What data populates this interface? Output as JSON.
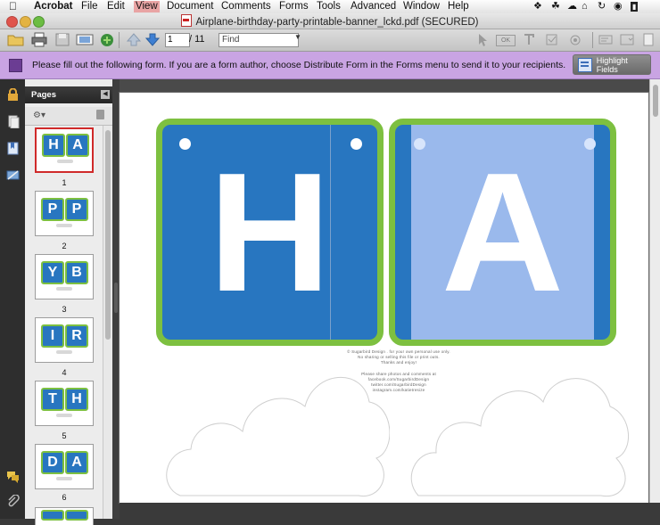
{
  "menubar": {
    "app": "Acrobat",
    "items": [
      "File",
      "Edit",
      "View",
      "Document",
      "Comments",
      "Forms",
      "Tools",
      "Advanced",
      "Window",
      "Help"
    ]
  },
  "window": {
    "title": "Airplane-birthday-party-printable-banner_lckd.pdf (SECURED)"
  },
  "toolbar": {
    "page_value": "1",
    "page_count": "/  11",
    "find_placeholder": "Find"
  },
  "formbar": {
    "message": "Please fill out the following form. If you are a form author, choose Distribute Form in the Forms menu to send it to your recipients.",
    "highlight_label": "Highlight Fields"
  },
  "pages_panel": {
    "title": "Pages",
    "thumbnails": [
      {
        "left": "H",
        "right": "A",
        "number": "1"
      },
      {
        "left": "P",
        "right": "P",
        "number": "2"
      },
      {
        "left": "Y",
        "right": "B",
        "number": "3"
      },
      {
        "left": "I",
        "right": "R",
        "number": "4"
      },
      {
        "left": "T",
        "right": "H",
        "number": "5"
      },
      {
        "left": "D",
        "right": "A",
        "number": "6"
      }
    ]
  },
  "document": {
    "letter_left": "H",
    "letter_right": "A",
    "credits": [
      "© Sugarbird Design . for your own personal use only.",
      "No sharing or selling this file or print outs.",
      "Thanks and enjoy!",
      "Please share photos and comments at",
      "facebook.com/SugarbirdDesign",
      "twitter.com/SugarbirdDesign",
      "instagram.com/katietresize"
    ],
    "colors": {
      "flag_blue": "#2876c0",
      "flag_light": "#9ab9ec",
      "flag_border": "#7dc040"
    }
  }
}
